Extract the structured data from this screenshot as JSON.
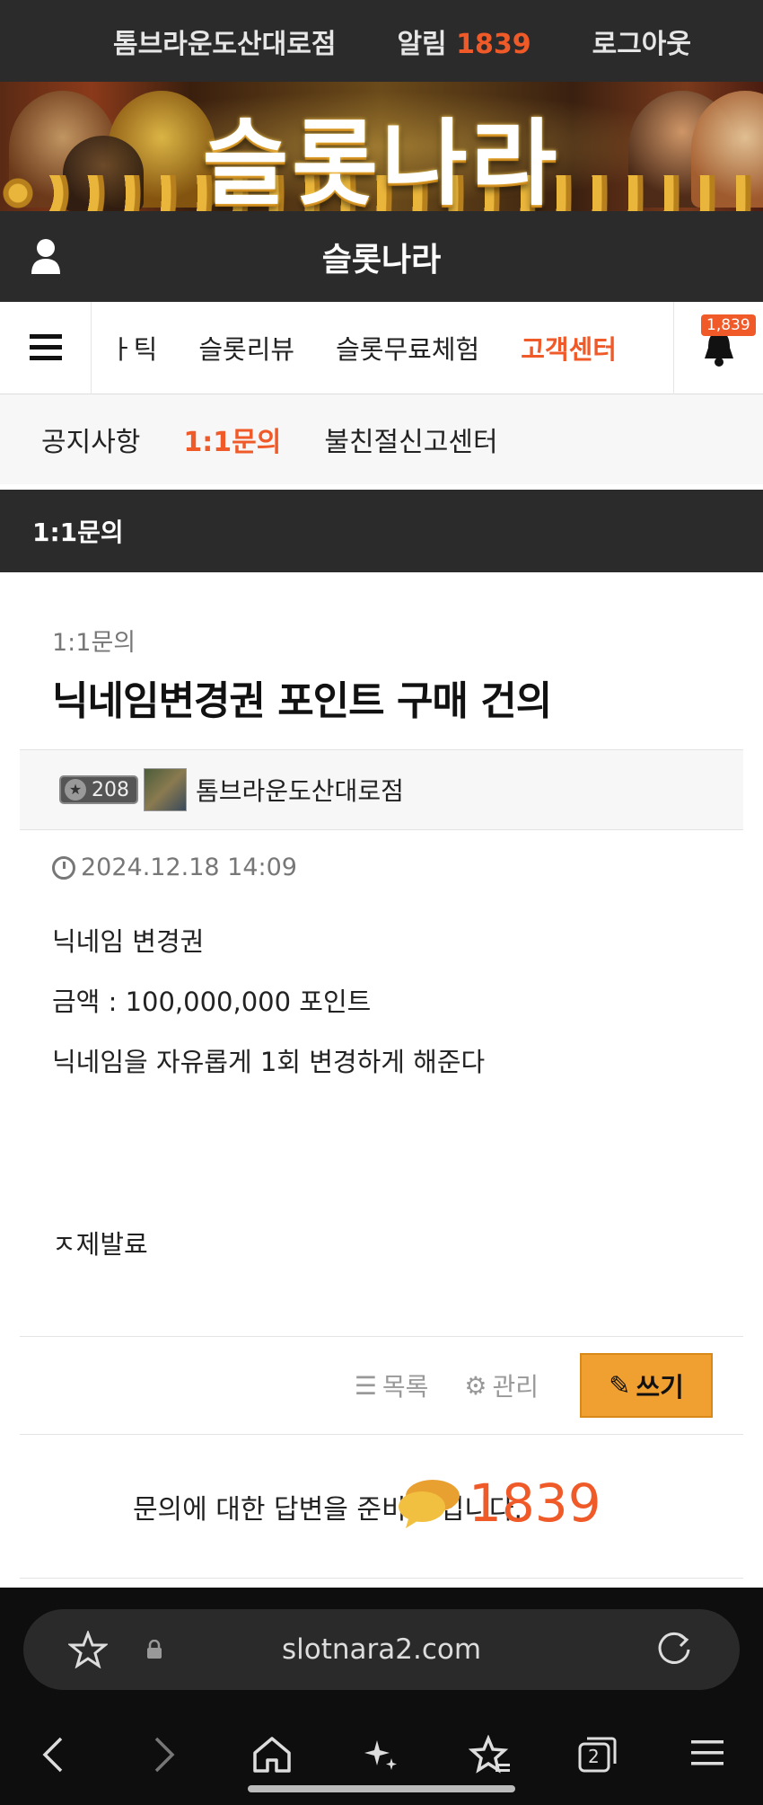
{
  "top": {
    "username": "톰브라운도산대로점",
    "alarm_label": "알림",
    "alarm_count": "1839",
    "logout": "로그아웃"
  },
  "banner": {
    "title": "슬롯나라"
  },
  "site": {
    "name": "슬롯나라"
  },
  "nav": {
    "items": [
      {
        "label": "ㅏ틱"
      },
      {
        "label": "슬롯리뷰"
      },
      {
        "label": "슬롯무료체험"
      },
      {
        "label": "고객센터",
        "active": true
      }
    ],
    "bell_badge": "1,839"
  },
  "subnav": {
    "items": [
      {
        "label": "공지사항"
      },
      {
        "label": "1:1문의",
        "active": true
      },
      {
        "label": "불친절신고센터"
      }
    ]
  },
  "board": {
    "title": "1:1문의"
  },
  "post": {
    "category": "1:1문의",
    "title": "닉네임변경권 포인트 구매 건의",
    "level": "208",
    "author": "톰브라운도산대로점",
    "datetime": "2024.12.18 14:09",
    "lines": [
      "닉네임 변경권",
      "금액 : 100,000,000 포인트",
      "닉네임을 자유롭게 1회 변경하게 해준다"
    ],
    "signature": "ㅈ제발료"
  },
  "actions": {
    "list": "목록",
    "manage": "관리",
    "write": "쓰기"
  },
  "answer": {
    "text": "문의에 대한 답변을 준비 중입니다.",
    "chat_count": "1839"
  },
  "browser": {
    "url": "slotnara2.com",
    "tab_count": "2"
  },
  "colors": {
    "accent": "#f05a28",
    "dark": "#2b2b2b",
    "button": "#f0a030"
  }
}
